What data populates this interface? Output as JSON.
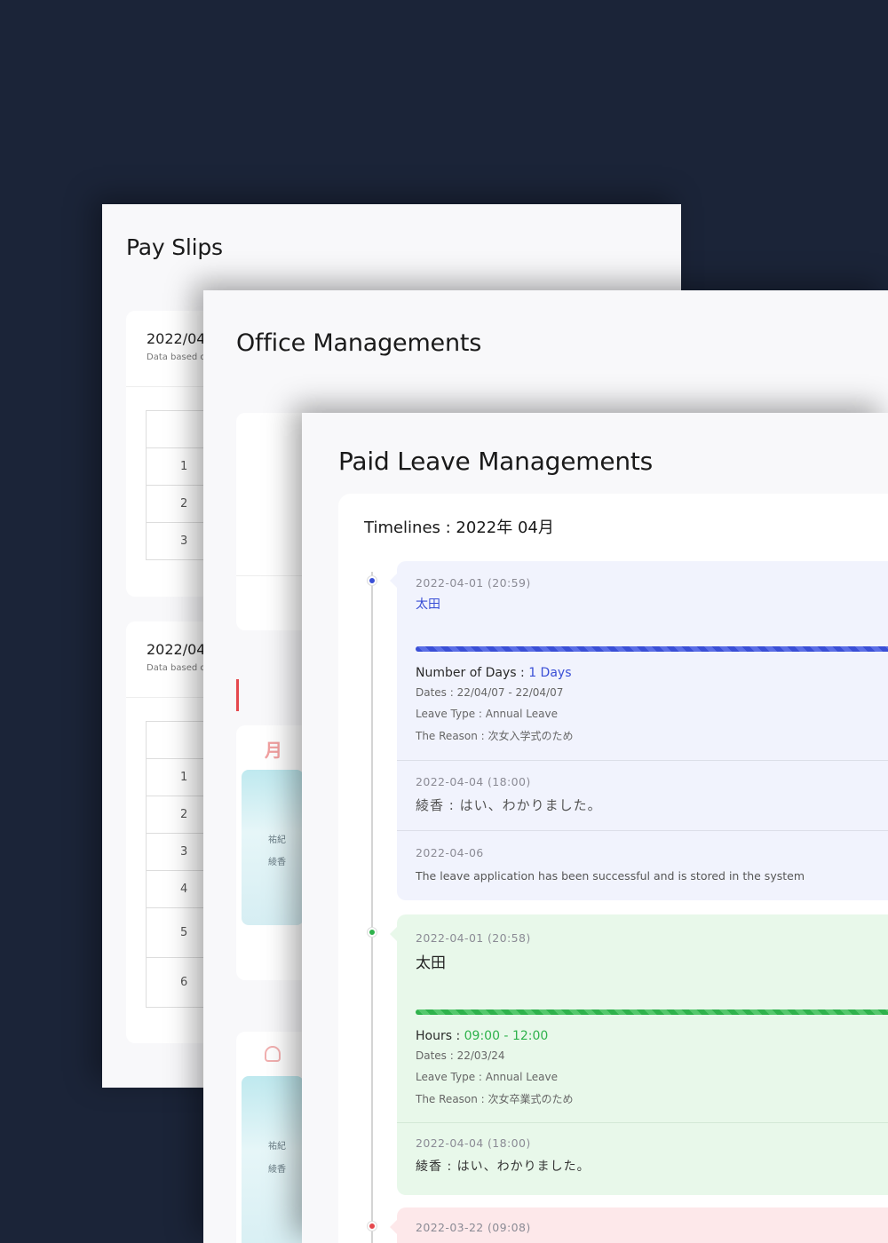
{
  "pay_slips": {
    "title": "Pay Slips",
    "cards": [
      {
        "month": "2022/04",
        "note": "Data based o",
        "rows": [
          "1",
          "2",
          "3"
        ]
      },
      {
        "month": "2022/04",
        "note": "Data based o",
        "rows": [
          "1",
          "2",
          "3",
          "4",
          "5",
          "6"
        ]
      }
    ]
  },
  "office": {
    "title": "Office Managements",
    "month_mark": "月",
    "names": [
      "祐紀",
      "綾香"
    ]
  },
  "leave": {
    "title": "Paid Leave Managements",
    "timeline_title": "Timelines : 2022年 04月",
    "colors": {
      "blue": "#3a4fd6",
      "green": "#2fb24c",
      "red": "#e5484d"
    },
    "entries": [
      {
        "timestamp": "2022-04-01 (20:59)",
        "name": "太田",
        "amount_label": "Number of Days : ",
        "amount_value": "1 Days",
        "dates": "Dates : 22/04/07 - 22/04/07",
        "leave_type": "Leave Type : Annual Leave",
        "reason": "The Reason : 次女入学式のため",
        "reply_ts": "2022-04-04 (18:00)",
        "reply": "綾香 : はい、わかりました。",
        "system_ts": "2022-04-06",
        "system_msg": "The leave application has been successful and is stored in the system"
      },
      {
        "timestamp": "2022-04-01 (20:58)",
        "name": "太田",
        "corner": "A",
        "amount_label": "Hours : ",
        "amount_value": "09:00 - 12:00",
        "dates": "Dates : 22/03/24",
        "leave_type": "Leave Type : Annual Leave",
        "reason": "The Reason : 次女卒業式のため",
        "reply_ts": "2022-04-04 (18:00)",
        "reply": "綾香 : はい、わかりました。"
      },
      {
        "timestamp": "2022-03-22 (09:08)"
      }
    ]
  }
}
